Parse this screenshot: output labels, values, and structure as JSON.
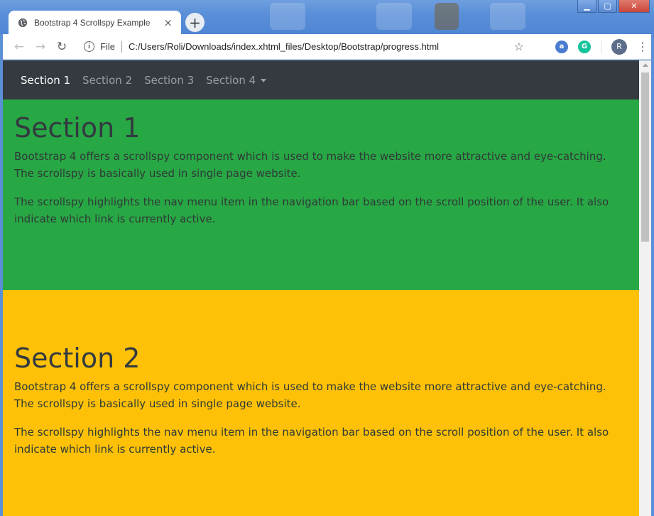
{
  "browser": {
    "tab_title": "Bootstrap 4 Scrollspy Example",
    "tab_close": "×",
    "new_tab": "+",
    "file_label": "File",
    "url": "C:/Users/Roli/Downloads/index.xhtml_files/Desktop/Bootstrap/progress.html",
    "avatar_letter": "R",
    "ext_a": "a",
    "ext_g": "G",
    "back_icon": "arrow-left",
    "forward_icon": "arrow-right",
    "reload_icon": "reload"
  },
  "navbar": {
    "links": [
      "Section 1",
      "Section 2",
      "Section 3",
      "Section 4"
    ],
    "active_index": 0
  },
  "sections": [
    {
      "title": "Section 1",
      "paragraphs": [
        "Bootstrap 4 offers a scrollspy component which is used to make the website more attractive and eye-catching. The scrollspy is basically used in single page website.",
        "The scrollspy highlights the nav menu item in the navigation bar based on the scroll position of the user. It also indicate which link is currently active."
      ],
      "background": "#28a745"
    },
    {
      "title": "Section 2",
      "paragraphs": [
        "Bootstrap 4 offers a scrollspy component which is used to make the website more attractive and eye-catching. The scrollspy is basically used in single page website.",
        "The scrollspy highlights the nav menu item in the navigation bar based on the scroll position of the user. It also indicate which link is currently active."
      ],
      "background": "#ffc107"
    }
  ],
  "colors": {
    "navbar_bg": "#343a40",
    "window_frame": "#5b8fd6"
  }
}
